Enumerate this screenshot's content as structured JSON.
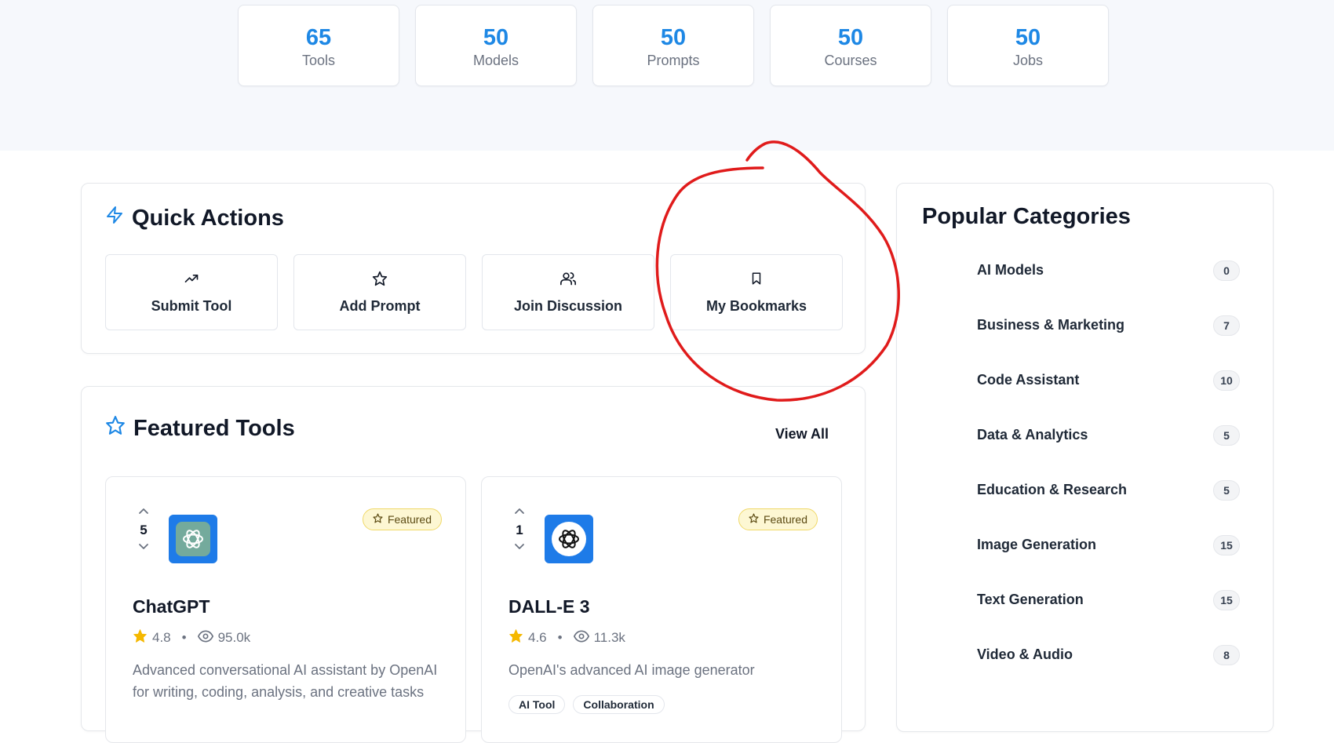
{
  "stats": [
    {
      "value": "65",
      "label": "Tools"
    },
    {
      "value": "50",
      "label": "Models"
    },
    {
      "value": "50",
      "label": "Prompts"
    },
    {
      "value": "50",
      "label": "Courses"
    },
    {
      "value": "50",
      "label": "Jobs"
    }
  ],
  "quick_actions": {
    "title": "Quick Actions",
    "icon": "lightning-icon",
    "buttons": [
      {
        "label": "Submit Tool",
        "icon": "trending-up-icon"
      },
      {
        "label": "Add Prompt",
        "icon": "star-icon"
      },
      {
        "label": "Join Discussion",
        "icon": "users-icon"
      },
      {
        "label": "My Bookmarks",
        "icon": "bookmark-icon"
      }
    ]
  },
  "featured_tools": {
    "title": "Featured Tools",
    "view_all": "View All",
    "tools": [
      {
        "votes": "5",
        "badge": "Featured",
        "name": "ChatGPT",
        "rating": "4.8",
        "views": "95.0k",
        "description": "Advanced conversational AI assistant by OpenAI for writing, coding, analysis, and creative tasks",
        "tags": []
      },
      {
        "votes": "1",
        "badge": "Featured",
        "name": "DALL-E 3",
        "rating": "4.6",
        "views": "11.3k",
        "description": "OpenAI's advanced AI image generator",
        "tags": [
          "AI Tool",
          "Collaboration"
        ]
      }
    ]
  },
  "popular_categories": {
    "title": "Popular Categories",
    "items": [
      {
        "name": "AI Models",
        "count": "0"
      },
      {
        "name": "Business & Marketing",
        "count": "7"
      },
      {
        "name": "Code Assistant",
        "count": "10"
      },
      {
        "name": "Data & Analytics",
        "count": "5"
      },
      {
        "name": "Education & Research",
        "count": "5"
      },
      {
        "name": "Image Generation",
        "count": "15"
      },
      {
        "name": "Text Generation",
        "count": "15"
      },
      {
        "name": "Video & Audio",
        "count": "8"
      }
    ]
  },
  "colors": {
    "accent": "#1e88e5",
    "annotation": "#e01b1b",
    "featured_bg": "#fdf7d3",
    "star": "#f5b800"
  }
}
